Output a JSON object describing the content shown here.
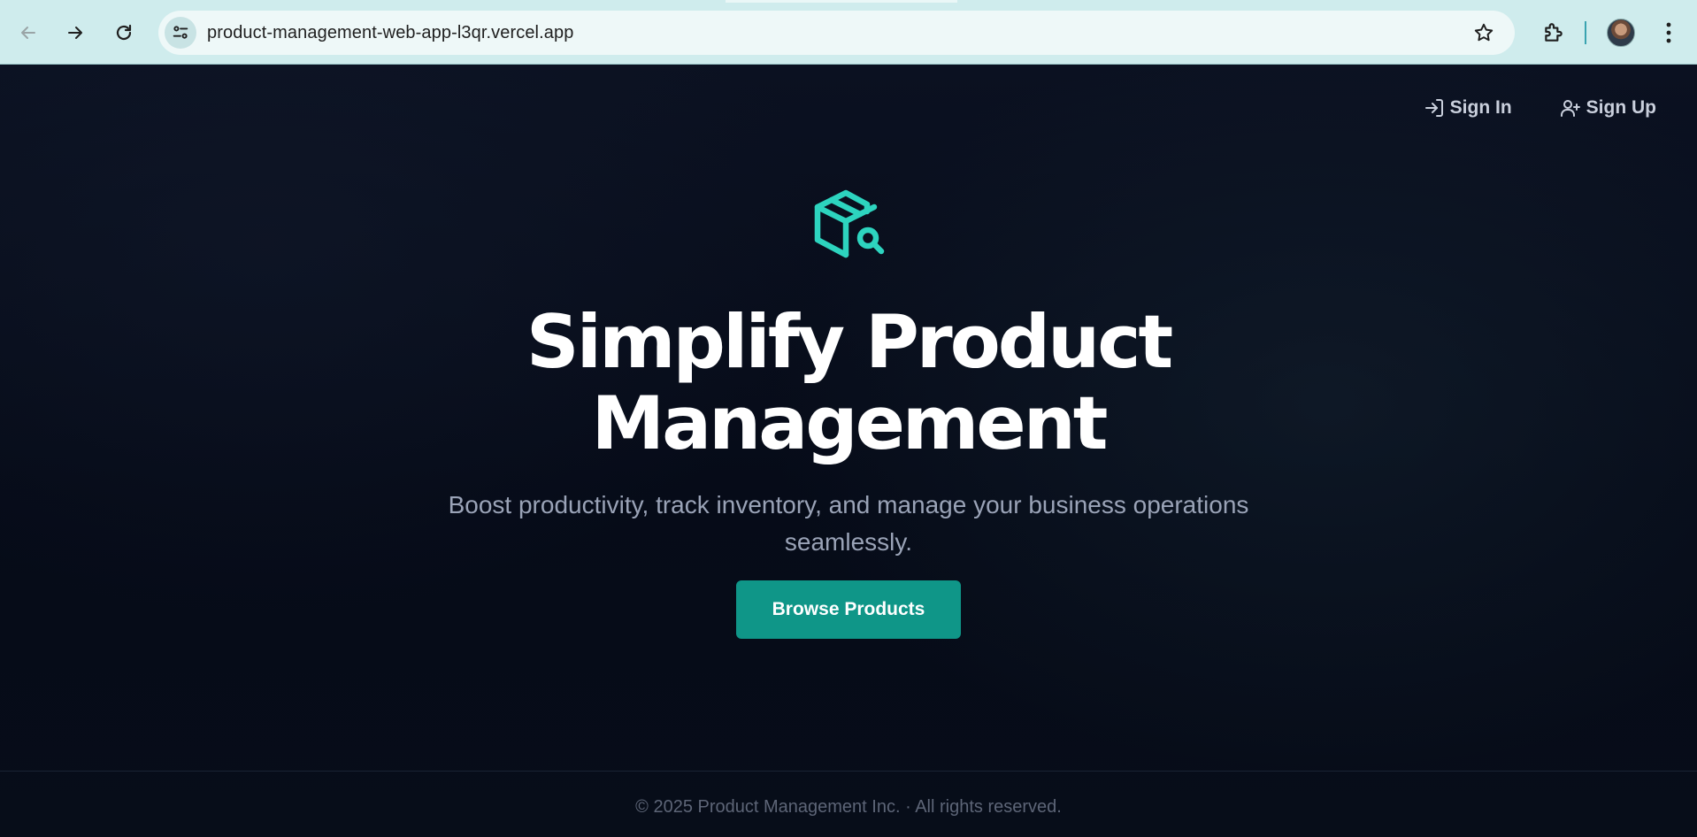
{
  "browser": {
    "url": "product-management-web-app-l3qr.vercel.app",
    "icons": {
      "back": "arrow-left-icon",
      "forward": "arrow-right-icon",
      "reload": "reload-icon",
      "site_info": "tune-icon",
      "bookmark": "star-icon",
      "extensions": "puzzle-icon",
      "menu": "kebab-menu-icon"
    }
  },
  "nav": {
    "sign_in": "Sign In",
    "sign_up": "Sign Up"
  },
  "hero": {
    "logo_icon": "package-search-icon",
    "title_line1": "Simplify Product",
    "title_line2": "Management",
    "subtitle": "Boost productivity, track inventory, and manage your business operations seamlessly.",
    "cta_label": "Browse Products"
  },
  "footer": {
    "copyright": "© 2025 Product Management Inc. · All rights reserved."
  },
  "colors": {
    "accent": "#2dd4bf",
    "button": "#0f9688",
    "background": "#060b18",
    "chrome": "#cfeced"
  }
}
